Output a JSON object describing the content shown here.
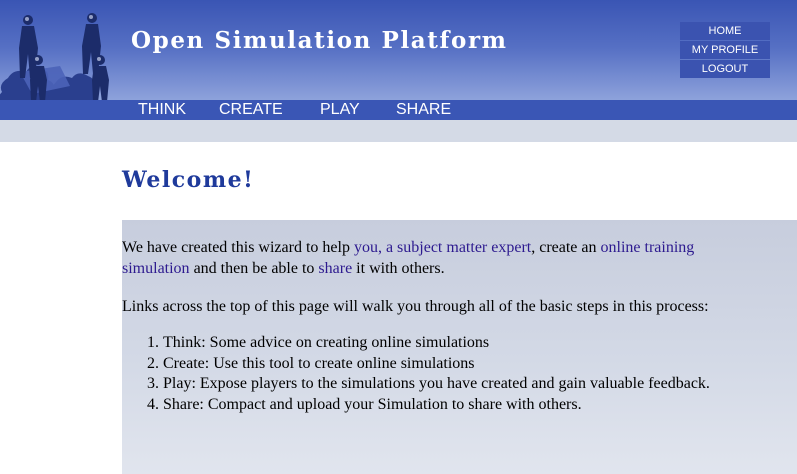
{
  "header": {
    "site_title": "Open Simulation Platform",
    "user_menu": [
      "HOME",
      "MY PROFILE",
      "LOGOUT"
    ],
    "nav": [
      "THINK",
      "CREATE",
      "PLAY",
      "SHARE"
    ]
  },
  "main": {
    "heading": "Welcome!",
    "intro": {
      "t1": "We have created this wizard to help ",
      "link1": "you, a subject matter expert",
      "t2": ", create an ",
      "link2a": "online training",
      "link2b": "simulation",
      "t3": " and then be able to ",
      "link3": "share",
      "t4": " it with others."
    },
    "links_text": "Links across the top of this page will walk you through all of the basic steps in this process:",
    "steps": [
      "Think: Some advice on creating online simulations",
      "Create: Use this tool to create online simulations",
      "Play: Expose players to the simulations you have created and gain valuable feedback.",
      "Share: Compact and upload your Simulation to share with others."
    ]
  },
  "colors": {
    "header_blue": "#3a55b4",
    "nav_blue": "#3a56b5",
    "heading_blue": "#1f3a9b",
    "link_purple": "#2d1a8f",
    "content_bg": "#d3d9e6"
  },
  "icons": {
    "logo": "puzzle-people-logo-icon"
  }
}
